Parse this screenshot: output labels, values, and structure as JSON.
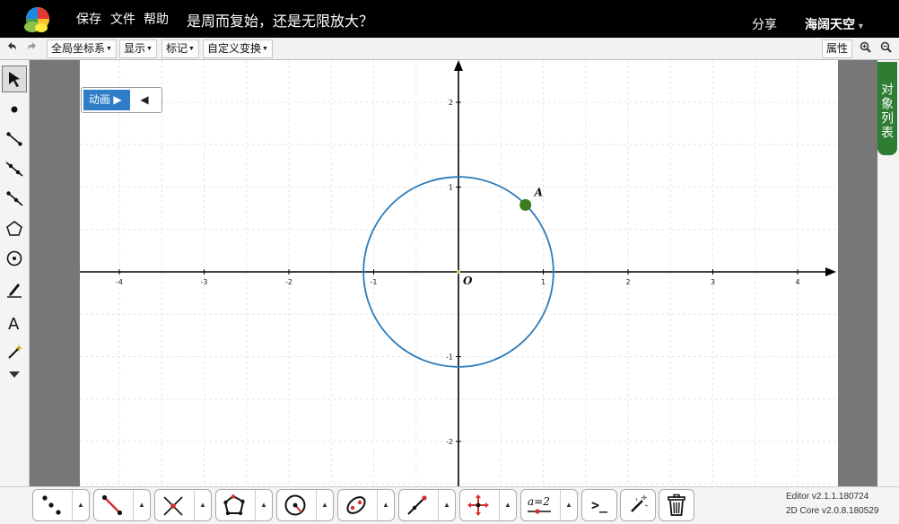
{
  "header": {
    "menu": [
      "保存",
      "文件",
      "帮助"
    ],
    "title": "是周而复始，还是无限放大？",
    "share": "分享",
    "user": "海阔天空"
  },
  "toolbar": {
    "undo_icon": "undo-icon",
    "redo_icon": "redo-icon",
    "coord_system": "全局坐标系",
    "display": "显示",
    "label": "标记",
    "custom_transform": "自定义变换",
    "properties": "属性"
  },
  "side_panel": {
    "object_list": "对象列表"
  },
  "animation": {
    "label": "动画"
  },
  "graph": {
    "x_ticks": [
      -4,
      -3,
      -2,
      -1,
      1,
      2,
      3,
      4
    ],
    "y_ticks": [
      -2,
      -1,
      1,
      2
    ],
    "origin_label": "O",
    "point_label": "A",
    "xlim": [
      -4.4,
      4.4
    ],
    "ylim": [
      -2.5,
      2.5
    ],
    "circle_radius": 1.12,
    "point": {
      "x": 0.79,
      "y": 0.79
    },
    "colors": {
      "circle": "#2b7bb9",
      "point": "#3a7d1e",
      "axis": "#000000",
      "grid": "#e6e6e6"
    }
  },
  "bottom_tools": {
    "variable_label": "a=2",
    "command_label": ">_"
  },
  "version": {
    "editor": "Editor v2.1.1.180724",
    "core": "2D Core v2.0.8.180529"
  }
}
